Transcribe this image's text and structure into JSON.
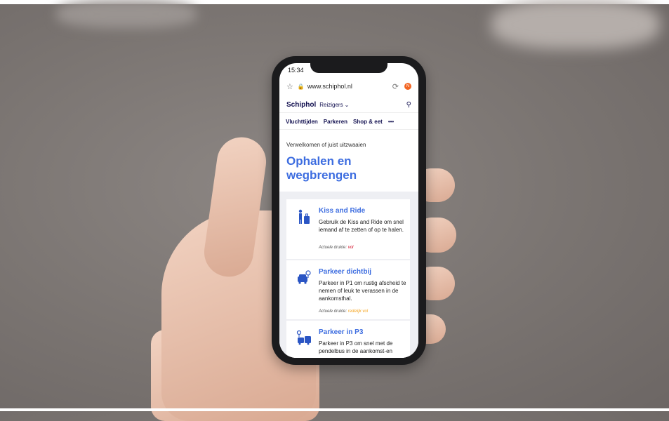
{
  "status": {
    "time": "15:34"
  },
  "browser": {
    "url": "www.schiphol.nl",
    "notification_badge": "N"
  },
  "site": {
    "logo": "Schiphol",
    "audience": "Reizigers"
  },
  "nav": [
    "Vluchttijden",
    "Parkeren",
    "Shop & eet",
    "•••"
  ],
  "page": {
    "intro": "Verwelkomen of juist uitzwaaien",
    "title": "Ophalen en wegbrengen"
  },
  "cards": [
    {
      "title": "Kiss and Ride",
      "text": "Gebruik de Kiss and Ride om snel iemand af te zetten of op te halen.",
      "crowd_label": "Actuele drukte:",
      "crowd_value": "vol"
    },
    {
      "title": "Parkeer dichtbij",
      "text": "Parkeer in P1 om rustig afscheid te nemen of leuk te verassen in de aankomsthal.",
      "crowd_label": "Actuele drukte:",
      "crowd_value": "redelijk vol"
    },
    {
      "title": "Parkeer in P3",
      "text": "Parkeer in P3 om snel met de pendelbus in de aankomst-en"
    }
  ],
  "colors": {
    "accent": "#3d6de0",
    "brand": "#141251",
    "full": "#d0021b",
    "busy": "#f5a623"
  }
}
